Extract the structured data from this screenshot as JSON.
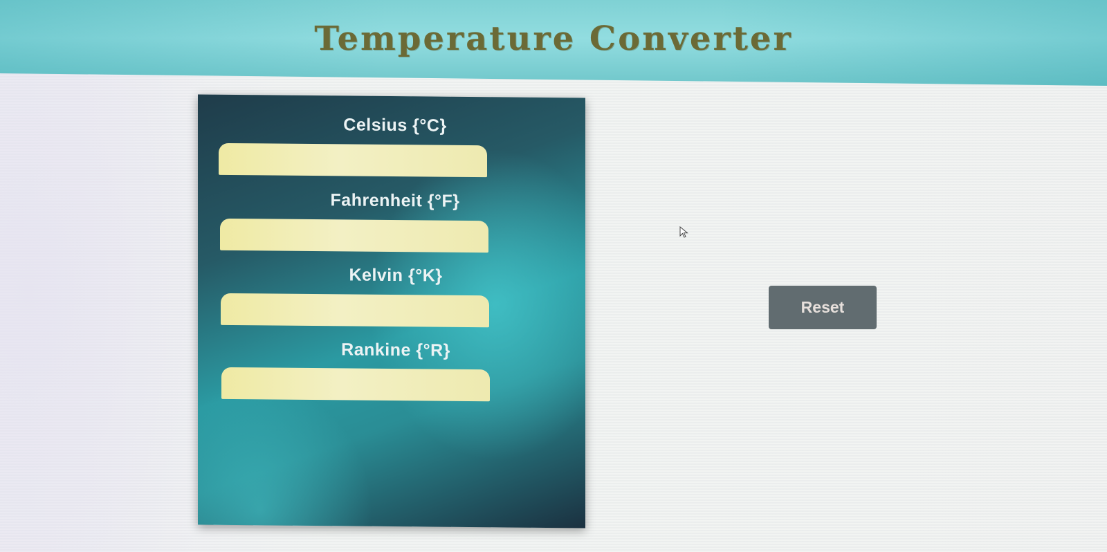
{
  "header": {
    "title": "Temperature Converter"
  },
  "converter": {
    "fields": [
      {
        "label": "Celsius {°C}",
        "value": "",
        "placeholder": ""
      },
      {
        "label": "Fahrenheit {°F}",
        "value": "",
        "placeholder": ""
      },
      {
        "label": "Kelvin {°K}",
        "value": "",
        "placeholder": ""
      },
      {
        "label": "Rankine {°R}",
        "value": "",
        "placeholder": ""
      }
    ]
  },
  "actions": {
    "reset_label": "Reset"
  },
  "colors": {
    "header": "#86d6d9",
    "title": "#6b6a36",
    "panel_dark": "#1f3c4a",
    "panel_teal": "#2b9aa2",
    "input_fill": "#efeaa4",
    "reset_button": "#616c70"
  },
  "icons": {
    "pointer": "mouse-pointer-icon"
  }
}
